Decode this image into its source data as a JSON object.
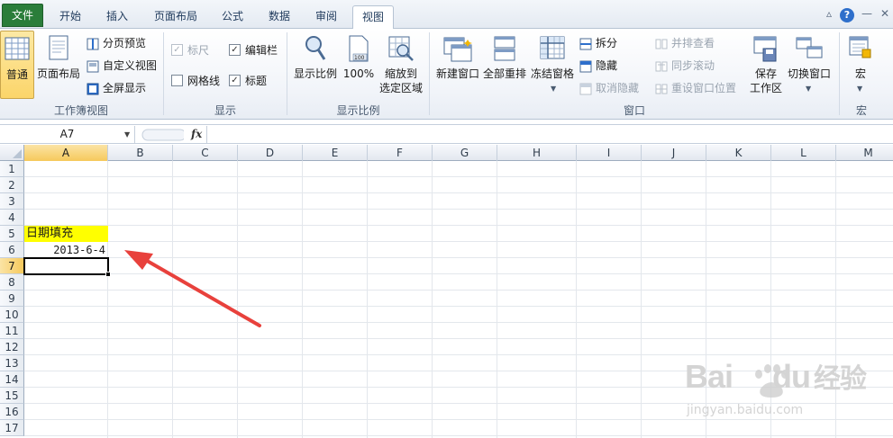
{
  "tabs": {
    "file": "文件",
    "home": "开始",
    "insert": "插入",
    "page_layout": "页面布局",
    "formulas": "公式",
    "data": "数据",
    "review": "审阅",
    "view": "视图"
  },
  "window_controls": {
    "minimize_ribbon": "▵",
    "help": "?",
    "min": "—",
    "restore": "❐",
    "close": "✕"
  },
  "ribbon": {
    "workbook_views": {
      "label": "工作簿视图",
      "normal": "普通",
      "page_layout": "页面布局",
      "page_break_preview": "分页预览",
      "custom_views": "自定义视图",
      "full_screen": "全屏显示"
    },
    "show": {
      "label": "显示",
      "ruler": "标尺",
      "formula_bar": "编辑栏",
      "gridlines": "网格线",
      "headings": "标题"
    },
    "zoom": {
      "label": "显示比例",
      "zoom": "显示比例",
      "hundred": "100%",
      "zoom_to_selection_1": "缩放到",
      "zoom_to_selection_2": "选定区域"
    },
    "window": {
      "label": "窗口",
      "new_window": "新建窗口",
      "arrange_all": "全部重排",
      "freeze_panes": "冻结窗格",
      "split": "拆分",
      "hide": "隐藏",
      "unhide": "取消隐藏",
      "view_side_by_side": "并排查看",
      "sync_scroll": "同步滚动",
      "reset_position": "重设窗口位置",
      "save_workspace_1": "保存",
      "save_workspace_2": "工作区",
      "switch_windows": "切换窗口"
    },
    "macros": {
      "label": "宏",
      "macros": "宏"
    }
  },
  "formula_bar": {
    "name_box": "A7",
    "fx": "fx",
    "value": ""
  },
  "columns": [
    "A",
    "B",
    "C",
    "D",
    "E",
    "F",
    "G",
    "H",
    "I",
    "J",
    "K",
    "L",
    "M"
  ],
  "rows": [
    "1",
    "2",
    "3",
    "4",
    "5",
    "6",
    "7",
    "8",
    "9",
    "10",
    "11",
    "12",
    "13",
    "14",
    "15",
    "16",
    "17"
  ],
  "selected": {
    "column": "A",
    "row": "7"
  },
  "cells": {
    "A5": "日期填充",
    "A6": "2013-6-4"
  },
  "colors": {
    "highlight": "#ffff00",
    "accent_file_tab": "#2a7d3a",
    "arrow": "#e8413c"
  },
  "watermark": {
    "brand": "Bai",
    "brand2": "du",
    "cn": "经验",
    "url": "jingyan.baidu.com"
  }
}
